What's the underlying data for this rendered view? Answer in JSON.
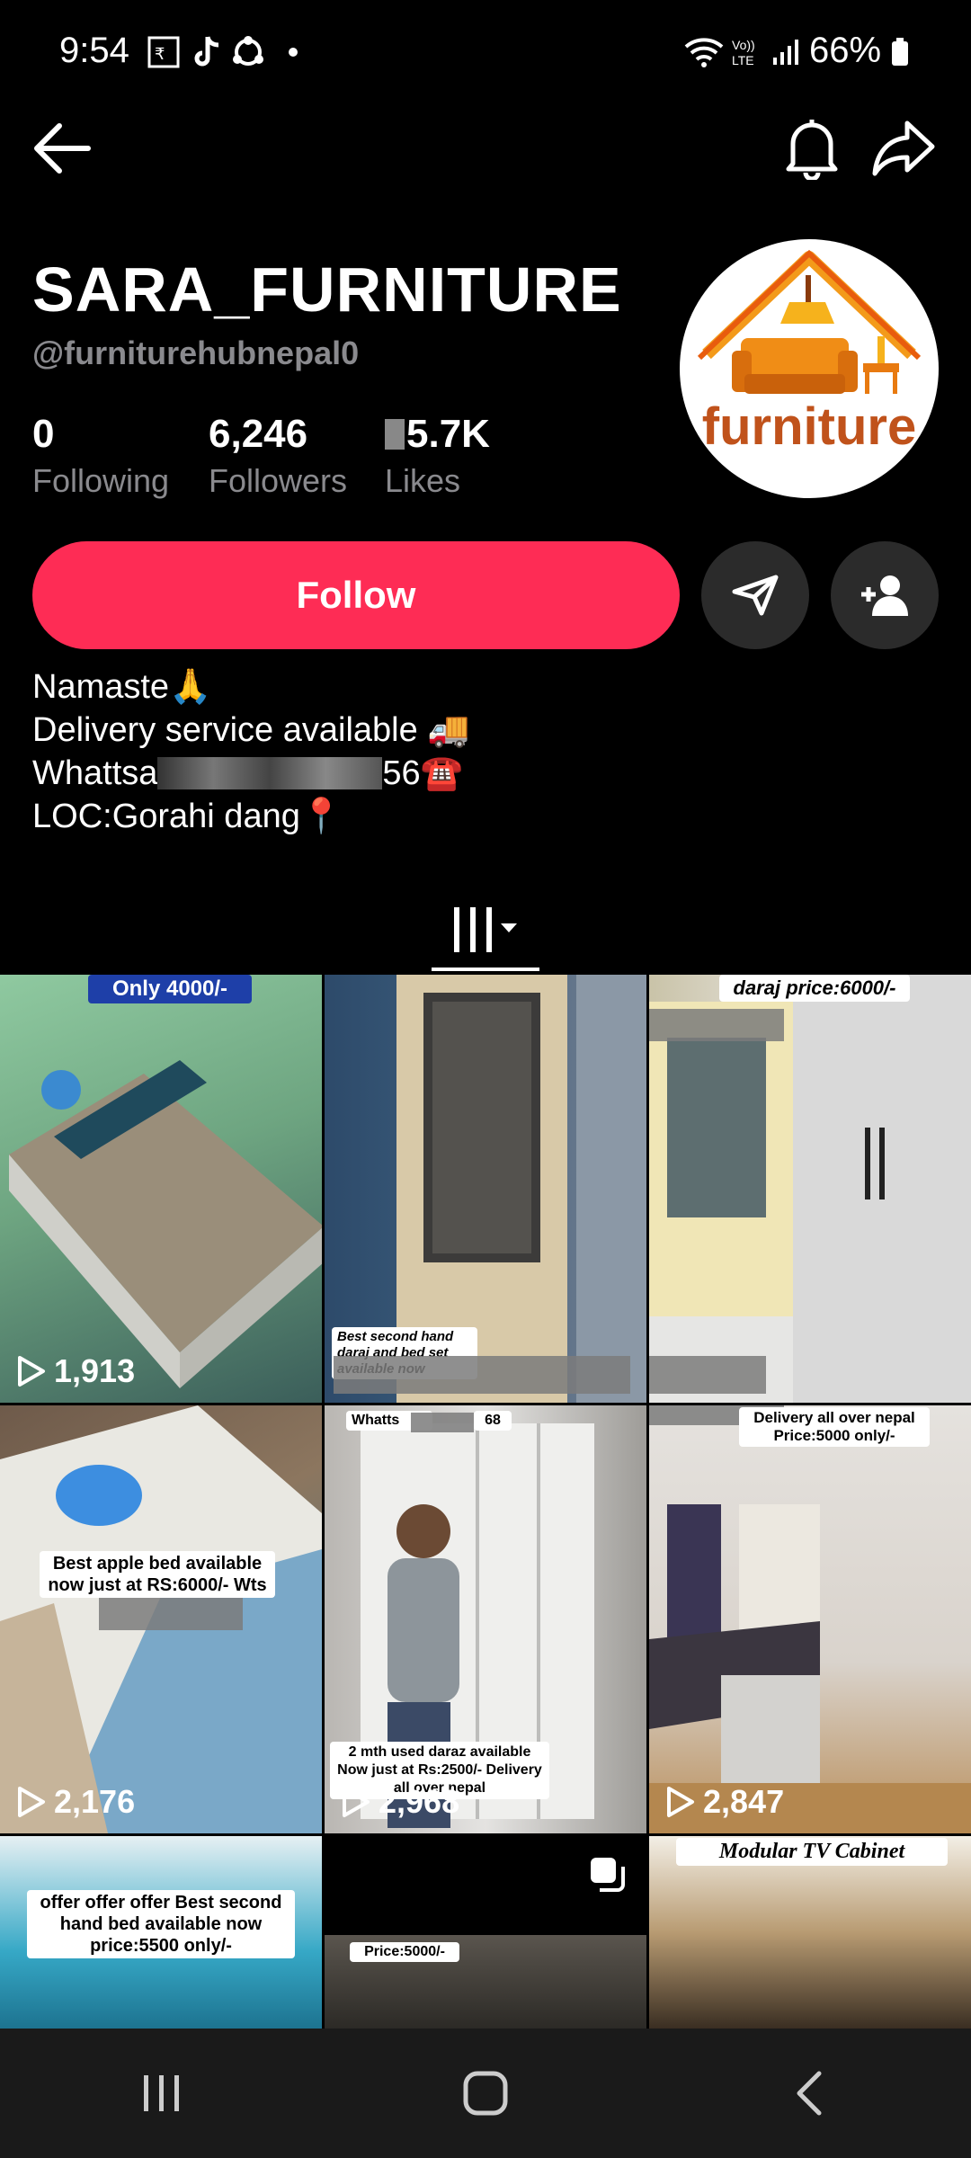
{
  "status_bar": {
    "time": "9:54",
    "battery": "66%"
  },
  "profile": {
    "name": "SARA_FURNITURE",
    "handle": "@furniturehubnepal0",
    "avatar_text": "furniture"
  },
  "stats": [
    {
      "value": "0",
      "label": "Following"
    },
    {
      "value": "6,246",
      "label": "Followers"
    },
    {
      "value": "5.7K",
      "label": "Likes"
    }
  ],
  "actions": {
    "follow_label": "Follow"
  },
  "bio": [
    "Namaste🙏",
    "Delivery service available 🚚",
    "Whattsa",
    "LOC:Gorahi dang📍"
  ],
  "bio_whatsapp_tail": "56☎️",
  "videos": [
    {
      "views": "1,913",
      "caption": "Only 4000/-"
    },
    {
      "views": "",
      "caption": "Best second hand daraj and bed set available now"
    },
    {
      "views": "",
      "caption": "daraj price:6000/-"
    },
    {
      "views": "2,176",
      "caption": "Best apple bed available now just at RS:6000/- Wts"
    },
    {
      "views": "2,968",
      "caption": "2 mth used daraz available Now just at Rs:2500/- Delivery all over nepal"
    },
    {
      "views": "2,847",
      "caption": "Delivery all over nepal Price:5000 only/-"
    },
    {
      "views": "",
      "caption": "offer offer offer Best second hand bed available now price:5500 only/-"
    },
    {
      "views": "",
      "caption": "Price:5000/-"
    },
    {
      "views": "",
      "caption": "Modular TV Cabinet"
    }
  ],
  "video_extra": {
    "whatts_label": "Whatts",
    "whatts_tail": "68"
  },
  "colors": {
    "accent": "#fe2c55",
    "muted": "#8a8a8e",
    "background": "#000000"
  }
}
